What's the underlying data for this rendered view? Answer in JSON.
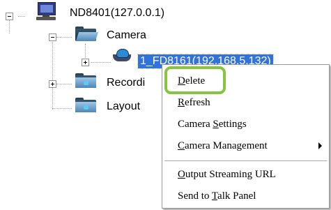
{
  "tree": {
    "server": {
      "label": "ND8401(127.0.0.1)",
      "expanded": true,
      "icon": "computer-icon"
    },
    "camera_folder": {
      "label": "Camera",
      "expanded": true,
      "icon": "open-folder-icon"
    },
    "camera_item": {
      "label": "1_FD8161(192.168.5.132)",
      "selected": true,
      "icon": "dome-camera-icon"
    },
    "recording_folder": {
      "label": "Recordi",
      "expanded": false,
      "icon": "folder-icon"
    },
    "layout_folder": {
      "label": "Layout",
      "expanded": false,
      "icon": "folder-icon"
    }
  },
  "context_menu": {
    "items": [
      {
        "pre": "",
        "key": "D",
        "post": "elete"
      },
      {
        "pre": "",
        "key": "R",
        "post": "efresh"
      },
      {
        "pre": "Camera ",
        "key": "S",
        "post": "ettings"
      },
      {
        "pre": "",
        "key": "C",
        "post": "amera Management",
        "submenu": true
      },
      {
        "pre": "",
        "key": "O",
        "post": "utput Streaming URL"
      },
      {
        "pre": "Send to ",
        "key": "T",
        "post": "alk Panel"
      }
    ],
    "highlighted": "Delete"
  },
  "colors": {
    "selection": "#3173d6",
    "highlight_ring": "#87c541"
  }
}
